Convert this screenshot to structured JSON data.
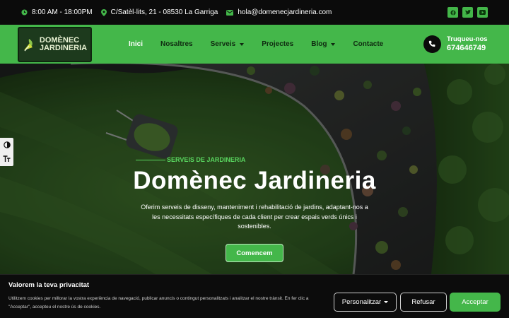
{
  "topbar": {
    "hours": "8:00 AM - 18:00PM",
    "address": "C/Satèl·lits, 21 - 08530 La Garriga",
    "email": "hola@domenecjardineria.com",
    "socials": [
      "facebook-icon",
      "twitter-icon",
      "youtube-icon"
    ]
  },
  "logo": {
    "line1": "DOMÈNEC",
    "line2": "JARDINERIA"
  },
  "nav": {
    "items": [
      {
        "label": "Inici",
        "active": true,
        "dropdown": false
      },
      {
        "label": "Nosaltres",
        "active": false,
        "dropdown": false
      },
      {
        "label": "Serveis",
        "active": false,
        "dropdown": true
      },
      {
        "label": "Projectes",
        "active": false,
        "dropdown": false
      },
      {
        "label": "Blog",
        "active": false,
        "dropdown": true
      },
      {
        "label": "Contacte",
        "active": false,
        "dropdown": false
      }
    ]
  },
  "phone": {
    "label": "Truqueu-nos",
    "number": "674646749"
  },
  "hero": {
    "eyebrow": "SERVEIS DE JARDINERIA",
    "title": "Domènec Jardineria",
    "description": "Oferim serveis de disseny, manteniment i rehabilitació de jardins, adaptant-nos a les necessitats específiques de cada client per crear espais verds únics i sostenibles.",
    "cta": "Comencem"
  },
  "cookie": {
    "title": "Valorem la teva privacitat",
    "text": "Utilitzem cookies per millorar la vostra experiència de navegació, publicar anuncis o contingut personalitzats i analitzar el nostre trànsit. En fer clic a \"Acceptar\", accepteu el nostre ús de cookies.",
    "customize": "Personalitzar",
    "reject": "Refusar",
    "accept": "Acceptar"
  },
  "colors": {
    "brand_green": "#44b74a",
    "dark": "#0b0b0b"
  }
}
